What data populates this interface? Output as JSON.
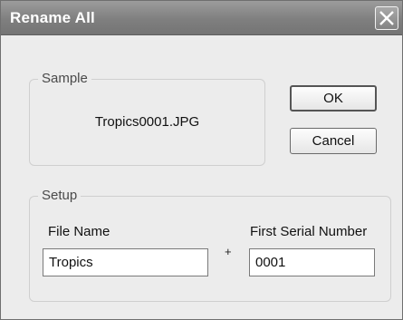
{
  "window": {
    "title": "Rename All",
    "close_icon": "close-icon"
  },
  "sample": {
    "group_label": "Sample",
    "preview_text": "Tropics0001.JPG"
  },
  "buttons": {
    "ok_label": "OK",
    "cancel_label": "Cancel"
  },
  "setup": {
    "group_label": "Setup",
    "file_name_label": "File Name",
    "file_name_value": "Tropics",
    "plus_sign": "+",
    "serial_label": "First Serial Number",
    "serial_value": "0001"
  },
  "colors": {
    "titlebar": "#7f7f7f",
    "window_bg": "#ececec"
  }
}
